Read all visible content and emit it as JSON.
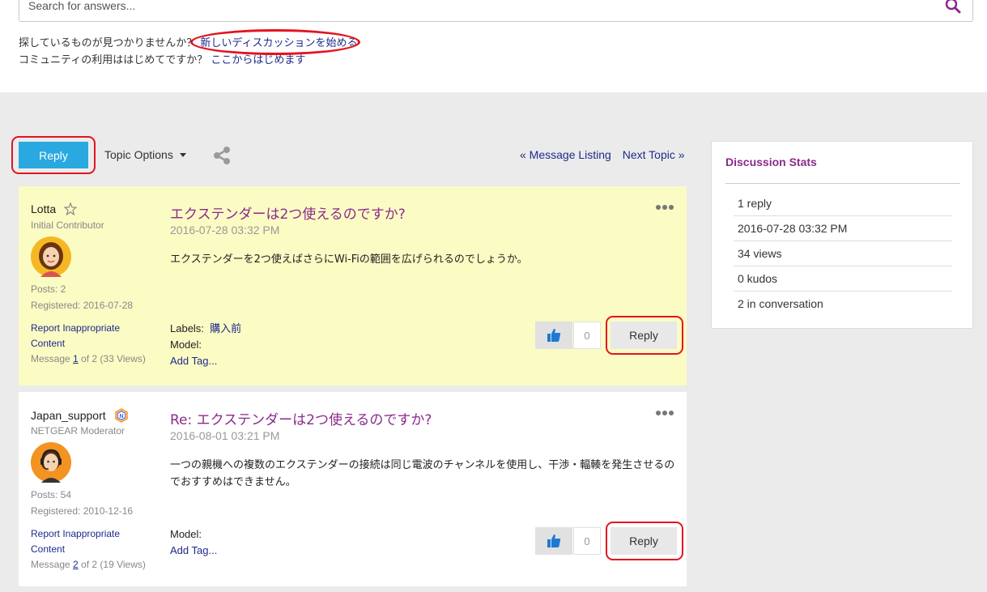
{
  "search": {
    "placeholder": "Search for answers..."
  },
  "help": {
    "q1": "探しているものが見つかりませんか？",
    "link1": "新しいディスカッションを始める",
    "q2": "コミュニティの利用ははじめてですか？",
    "link2": "ここからはじめます"
  },
  "toolbar": {
    "reply_label": "Reply",
    "topic_options_label": "Topic Options",
    "message_listing_label": "« Message Listing",
    "next_topic_label": "Next Topic »"
  },
  "posts": [
    {
      "author": "Lotta",
      "rank": "Initial Contributor",
      "posts": "Posts: 2",
      "registered": "Registered: 2016-07-28",
      "report": "Report Inappropriate Content",
      "message_prefix": "Message ",
      "message_num": "1",
      "message_suffix": " of 2 (33 Views)",
      "title": "エクステンダーは2つ使えるのですか?",
      "date": "2016-07-28 03:32 PM",
      "body": "エクステンダーを2つ使えばさらにWi-Fiの範囲を広げられるのでしょうか。",
      "labels_label": "Labels:",
      "label_value": "購入前",
      "model_label": "Model:",
      "add_tag": "Add Tag...",
      "kudos": "0",
      "reply_label": "Reply"
    },
    {
      "author": "Japan_support",
      "rank": "NETGEAR Moderator",
      "posts": "Posts: 54",
      "registered": "Registered: 2010-12-16",
      "report": "Report Inappropriate Content",
      "message_prefix": "Message ",
      "message_num": "2",
      "message_suffix": " of 2 (19 Views)",
      "title": "Re: エクステンダーは2つ使えるのですか?",
      "date": "2016-08-01 03:21 PM",
      "body": "一つの親機への複数のエクステンダーの接続は同じ電波のチャンネルを使用し、干渉・輻輳を発生させるのでおすすめはできません。",
      "model_label": "Model:",
      "add_tag": "Add Tag...",
      "kudos": "0",
      "reply_label": "Reply"
    }
  ],
  "stats": {
    "title": "Discussion Stats",
    "items": [
      "1 reply",
      "2016-07-28 03:32 PM",
      "34 views",
      "0 kudos",
      "2 in conversation"
    ]
  },
  "colors": {
    "accent": "#29a9e0",
    "title": "#8b2a8c",
    "link": "#1e2a8c",
    "highlight": "#fbfbc4",
    "annotation": "#e3141f"
  }
}
